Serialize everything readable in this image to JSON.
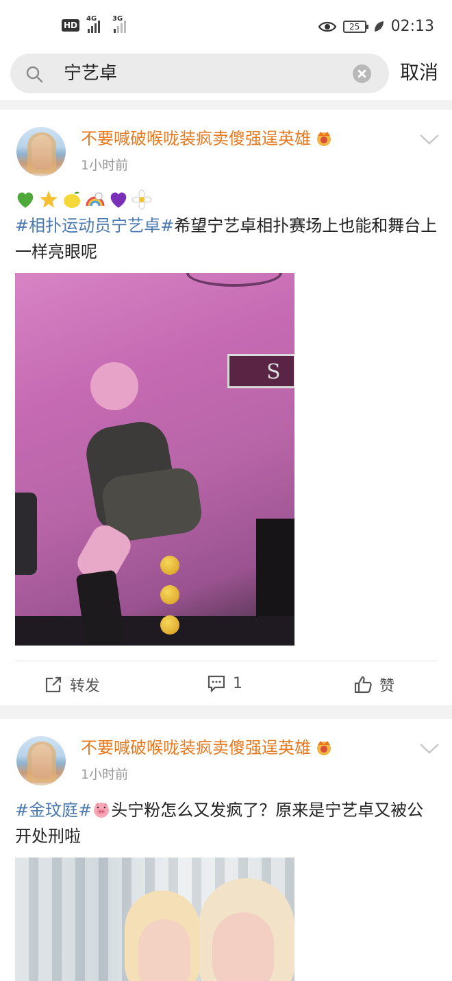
{
  "status_bar": {
    "hd_label": "HD",
    "signal1_label": "4G",
    "signal2_label": "3G",
    "battery": "25",
    "time": "02:13"
  },
  "search": {
    "query": "宁艺卓",
    "cancel_label": "取消"
  },
  "posts": [
    {
      "username": "不要喊破喉咙装疯卖傻强逞英雄",
      "time": "1小时前",
      "emojis": [
        "green-heart",
        "star",
        "lemon",
        "rainbow-unicorn",
        "purple-heart",
        "white-flower"
      ],
      "hashtag": "#相扑运动员宁艺卓#",
      "text": "希望宁艺卓相扑赛场上也能和舞台上一样亮眼呢",
      "image_sign_text": "S",
      "actions": {
        "repost_label": "转发",
        "comment_count": "1",
        "like_label": "赞"
      }
    },
    {
      "username": "不要喊破喉咙装疯卖傻强逞英雄",
      "time": "1小时前",
      "hashtag": "#金玟庭#",
      "text": "头宁粉怎么又发疯了？原来是宁艺卓又被公开处刑啦"
    }
  ],
  "colors": {
    "username": "#e8791f",
    "hashtag": "#4a78b0",
    "timestamp": "#999999",
    "background": "#f2f2f2"
  }
}
